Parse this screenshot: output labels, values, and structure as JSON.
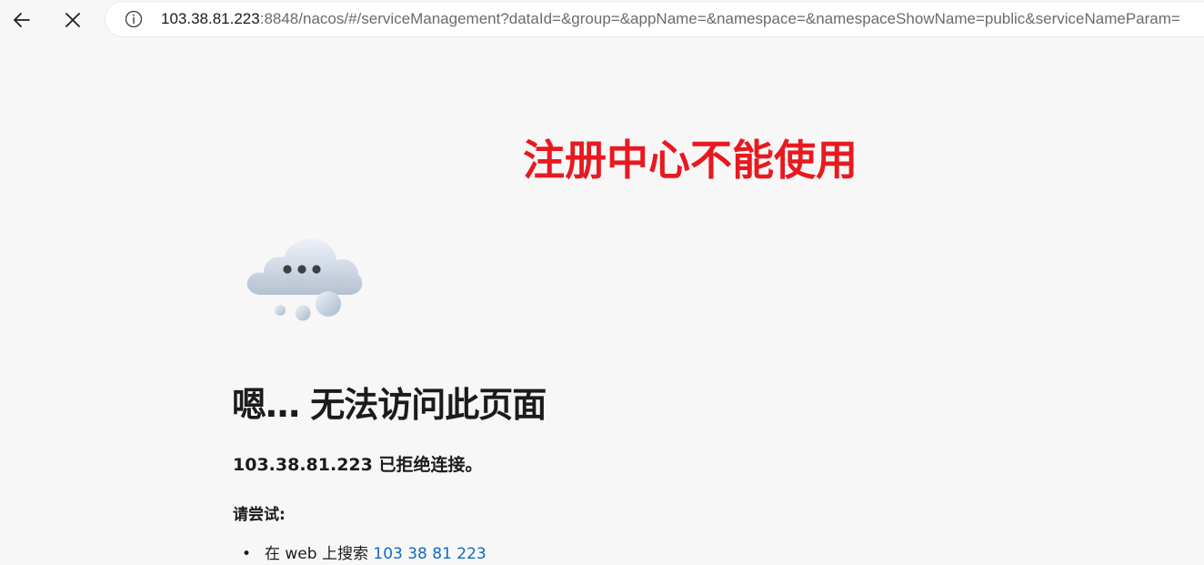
{
  "browser": {
    "back_icon": "arrow-left-icon",
    "stop_icon": "close-icon",
    "info_icon": "info-circle-icon",
    "address_bar": {
      "host": "103.38.81.223",
      "rest": ":8848/nacos/#/serviceManagement?dataId=&group=&appName=&namespace=&namespaceShowName=public&serviceNameParam="
    }
  },
  "annotation": {
    "text": "注册中心不能使用",
    "color": "#e8191f"
  },
  "error_page": {
    "illustration_icon": "thinking-cloud-icon",
    "heading": "嗯… 无法访问此页面",
    "detail": "103.38.81.223 已拒绝连接。",
    "try_label": "请尝试:",
    "suggestions": [
      {
        "bullet": "•",
        "prefix": "在 web 上搜索 ",
        "link_text": "103 38 81 223"
      }
    ],
    "link_color": "#0e6bbf"
  }
}
